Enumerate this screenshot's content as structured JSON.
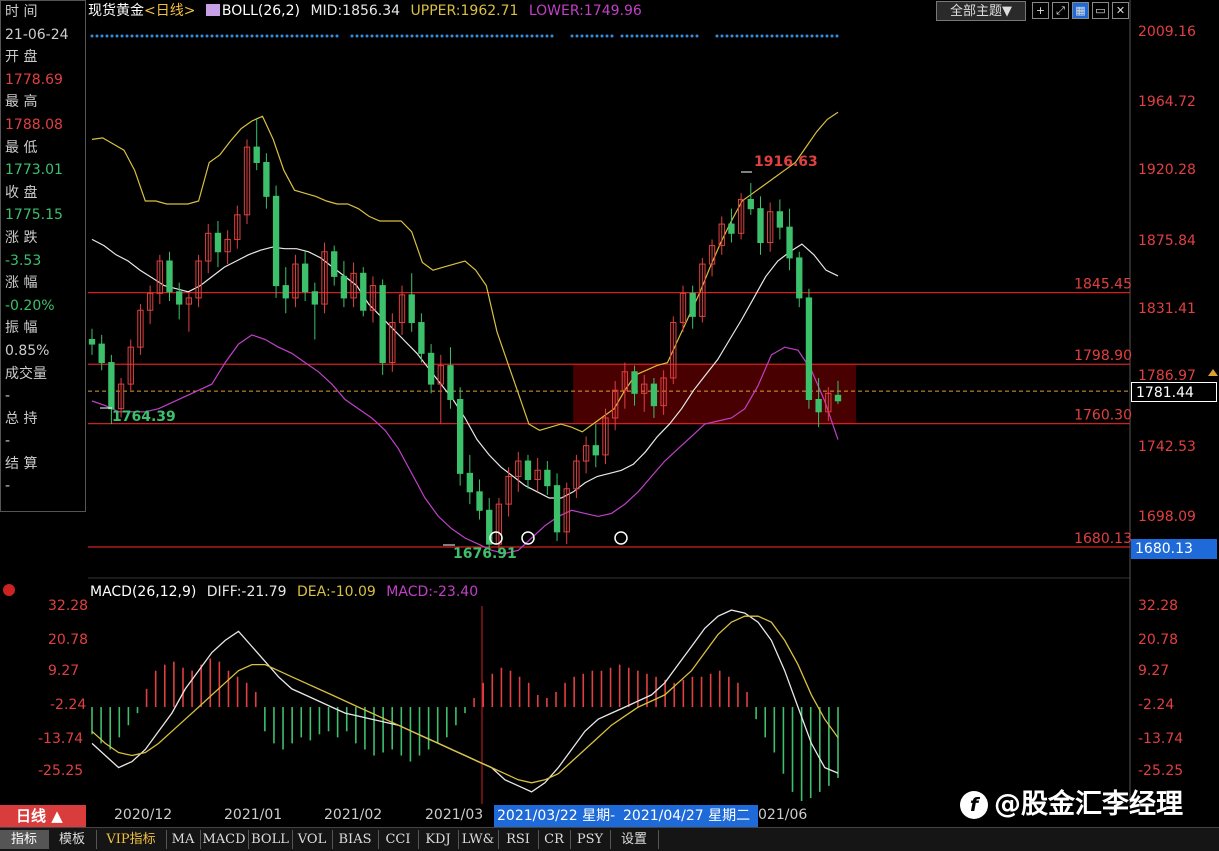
{
  "header": {
    "symbol": "现货黄金",
    "period": "<日线>",
    "indicator": "BOLL(26,2)",
    "mid": "MID:1856.34",
    "upper": "UPPER:1962.71",
    "lower": "LOWER:1749.96",
    "theme_button": "全部主题▼"
  },
  "toolbar_icons": [
    "crosshair-icon",
    "expand-icon",
    "chart-icon",
    "minimize-icon",
    "close-icon"
  ],
  "info_panel": {
    "rows": [
      {
        "text": "时 间",
        "color": "#cccccc"
      },
      {
        "text": "21-06-24",
        "color": "#cccccc"
      },
      {
        "text": "开 盘",
        "color": "#cccccc"
      },
      {
        "text": "1778.69",
        "color": "#e04040"
      },
      {
        "text": "最 高",
        "color": "#cccccc"
      },
      {
        "text": "1788.08",
        "color": "#e04040"
      },
      {
        "text": "最 低",
        "color": "#cccccc"
      },
      {
        "text": "1773.01",
        "color": "#3cc06c"
      },
      {
        "text": "收 盘",
        "color": "#cccccc"
      },
      {
        "text": "1775.15",
        "color": "#3cc06c"
      },
      {
        "text": "涨 跌",
        "color": "#cccccc"
      },
      {
        "text": "-3.53",
        "color": "#3cc06c"
      },
      {
        "text": "涨 幅",
        "color": "#cccccc"
      },
      {
        "text": "-0.20%",
        "color": "#3cc06c"
      },
      {
        "text": "振 幅",
        "color": "#cccccc"
      },
      {
        "text": "0.85%",
        "color": "#cccccc"
      },
      {
        "text": "成交量",
        "color": "#cccccc"
      },
      {
        "text": "-",
        "color": "#cccccc"
      },
      {
        "text": "总 持",
        "color": "#cccccc"
      },
      {
        "text": "-",
        "color": "#cccccc"
      },
      {
        "text": "结 算",
        "color": "#cccccc"
      },
      {
        "text": "-",
        "color": "#cccccc"
      }
    ]
  },
  "price_axis": {
    "ticks": [
      "2009.16",
      "1964.72",
      "1920.28",
      "1875.84",
      "1831.41",
      "1786.97",
      "1742.53",
      "1698.09"
    ],
    "current_price": "1781.44",
    "support_flag": "1680.13"
  },
  "levels": [
    {
      "label": "1845.45",
      "value": 1845.45
    },
    {
      "label": "1798.90",
      "value": 1798.9
    },
    {
      "label": "1760.30",
      "value": 1760.3
    },
    {
      "label": "1680.13",
      "value": 1680.13
    }
  ],
  "price_labels": {
    "high_label": "1916.63",
    "low_label": "1676.91",
    "start_label": "1764.39"
  },
  "macd": {
    "header_name": "MACD(26,12,9)",
    "diff": "DIFF:-21.79",
    "dea": "DEA:-10.09",
    "macd": "MACD:-23.40",
    "ticks": [
      "32.28",
      "20.78",
      "9.27",
      "-2.24",
      "-13.74",
      "-25.25"
    ]
  },
  "x_axis": {
    "labels": [
      "2020/12",
      "2021/01",
      "2021/02",
      "2021/03",
      "021/06"
    ],
    "cursor_date_1": "2021/03/22 星期-",
    "cursor_date_2": "2021/04/27 星期二"
  },
  "period_button": "日线 ▲",
  "tabs": [
    "指标",
    "模板",
    "VIP指标",
    "MA",
    "MACD",
    "BOLL",
    "VOL",
    "BIAS",
    "CCI",
    "KDJ",
    "LW&",
    "RSI",
    "CR",
    "PSY",
    "设置"
  ],
  "watermark": "@股金汇李经理",
  "colors": {
    "up": "#e04040",
    "down": "#3cc06c",
    "upper_band": "#d8c040",
    "mid_band": "#e8e8e8",
    "lower_band": "#c040c8",
    "level_line": "#d02020",
    "zone_fill": "#5a0000",
    "selected": "#1e6ad8"
  },
  "chart_data": {
    "type": "candlestick",
    "price_range": [
      1660,
      2020
    ],
    "candles": [
      {
        "o": 1815,
        "h": 1822,
        "l": 1805,
        "c": 1812
      },
      {
        "o": 1812,
        "h": 1818,
        "l": 1795,
        "c": 1800
      },
      {
        "o": 1800,
        "h": 1805,
        "l": 1760,
        "c": 1770
      },
      {
        "o": 1770,
        "h": 1790,
        "l": 1764.39,
        "c": 1786
      },
      {
        "o": 1786,
        "h": 1815,
        "l": 1782,
        "c": 1810
      },
      {
        "o": 1810,
        "h": 1838,
        "l": 1805,
        "c": 1834
      },
      {
        "o": 1834,
        "h": 1850,
        "l": 1825,
        "c": 1845
      },
      {
        "o": 1845,
        "h": 1870,
        "l": 1838,
        "c": 1866
      },
      {
        "o": 1866,
        "h": 1872,
        "l": 1840,
        "c": 1846
      },
      {
        "o": 1846,
        "h": 1852,
        "l": 1828,
        "c": 1838
      },
      {
        "o": 1838,
        "h": 1845,
        "l": 1820,
        "c": 1842
      },
      {
        "o": 1842,
        "h": 1870,
        "l": 1836,
        "c": 1866
      },
      {
        "o": 1866,
        "h": 1890,
        "l": 1858,
        "c": 1884
      },
      {
        "o": 1884,
        "h": 1892,
        "l": 1862,
        "c": 1872
      },
      {
        "o": 1872,
        "h": 1886,
        "l": 1864,
        "c": 1880
      },
      {
        "o": 1880,
        "h": 1902,
        "l": 1874,
        "c": 1896
      },
      {
        "o": 1896,
        "h": 1945,
        "l": 1890,
        "c": 1940
      },
      {
        "o": 1940,
        "h": 1959,
        "l": 1925,
        "c": 1930
      },
      {
        "o": 1930,
        "h": 1936,
        "l": 1900,
        "c": 1908
      },
      {
        "o": 1908,
        "h": 1915,
        "l": 1842,
        "c": 1850
      },
      {
        "o": 1850,
        "h": 1862,
        "l": 1832,
        "c": 1842
      },
      {
        "o": 1842,
        "h": 1870,
        "l": 1836,
        "c": 1864
      },
      {
        "o": 1864,
        "h": 1872,
        "l": 1840,
        "c": 1846
      },
      {
        "o": 1846,
        "h": 1852,
        "l": 1815,
        "c": 1838
      },
      {
        "o": 1838,
        "h": 1878,
        "l": 1832,
        "c": 1872
      },
      {
        "o": 1872,
        "h": 1876,
        "l": 1850,
        "c": 1856
      },
      {
        "o": 1856,
        "h": 1866,
        "l": 1836,
        "c": 1842
      },
      {
        "o": 1842,
        "h": 1865,
        "l": 1836,
        "c": 1858
      },
      {
        "o": 1858,
        "h": 1862,
        "l": 1830,
        "c": 1834
      },
      {
        "o": 1834,
        "h": 1856,
        "l": 1826,
        "c": 1850
      },
      {
        "o": 1850,
        "h": 1854,
        "l": 1792,
        "c": 1800
      },
      {
        "o": 1800,
        "h": 1832,
        "l": 1794,
        "c": 1826
      },
      {
        "o": 1826,
        "h": 1850,
        "l": 1818,
        "c": 1844
      },
      {
        "o": 1844,
        "h": 1858,
        "l": 1820,
        "c": 1826
      },
      {
        "o": 1826,
        "h": 1832,
        "l": 1800,
        "c": 1806
      },
      {
        "o": 1806,
        "h": 1812,
        "l": 1780,
        "c": 1786
      },
      {
        "o": 1786,
        "h": 1805,
        "l": 1760,
        "c": 1798
      },
      {
        "o": 1798,
        "h": 1810,
        "l": 1770,
        "c": 1776
      },
      {
        "o": 1776,
        "h": 1784,
        "l": 1720,
        "c": 1728
      },
      {
        "o": 1728,
        "h": 1740,
        "l": 1708,
        "c": 1716
      },
      {
        "o": 1716,
        "h": 1724,
        "l": 1698,
        "c": 1704
      },
      {
        "o": 1704,
        "h": 1712,
        "l": 1676.91,
        "c": 1682
      },
      {
        "o": 1682,
        "h": 1712,
        "l": 1678,
        "c": 1708
      },
      {
        "o": 1708,
        "h": 1732,
        "l": 1700,
        "c": 1726
      },
      {
        "o": 1726,
        "h": 1742,
        "l": 1716,
        "c": 1736
      },
      {
        "o": 1736,
        "h": 1740,
        "l": 1718,
        "c": 1724
      },
      {
        "o": 1724,
        "h": 1738,
        "l": 1716,
        "c": 1730
      },
      {
        "o": 1730,
        "h": 1736,
        "l": 1714,
        "c": 1720
      },
      {
        "o": 1720,
        "h": 1728,
        "l": 1684,
        "c": 1690
      },
      {
        "o": 1690,
        "h": 1722,
        "l": 1682,
        "c": 1718
      },
      {
        "o": 1718,
        "h": 1740,
        "l": 1712,
        "c": 1736
      },
      {
        "o": 1736,
        "h": 1752,
        "l": 1728,
        "c": 1746
      },
      {
        "o": 1746,
        "h": 1760,
        "l": 1732,
        "c": 1740
      },
      {
        "o": 1740,
        "h": 1770,
        "l": 1734,
        "c": 1764
      },
      {
        "o": 1764,
        "h": 1788,
        "l": 1756,
        "c": 1782
      },
      {
        "o": 1782,
        "h": 1800,
        "l": 1770,
        "c": 1794
      },
      {
        "o": 1794,
        "h": 1798,
        "l": 1772,
        "c": 1780
      },
      {
        "o": 1780,
        "h": 1792,
        "l": 1768,
        "c": 1786
      },
      {
        "o": 1786,
        "h": 1790,
        "l": 1764,
        "c": 1772
      },
      {
        "o": 1772,
        "h": 1795,
        "l": 1766,
        "c": 1790
      },
      {
        "o": 1790,
        "h": 1830,
        "l": 1786,
        "c": 1826
      },
      {
        "o": 1826,
        "h": 1850,
        "l": 1820,
        "c": 1845
      },
      {
        "o": 1845,
        "h": 1850,
        "l": 1822,
        "c": 1830
      },
      {
        "o": 1830,
        "h": 1868,
        "l": 1826,
        "c": 1864
      },
      {
        "o": 1864,
        "h": 1880,
        "l": 1856,
        "c": 1876
      },
      {
        "o": 1876,
        "h": 1895,
        "l": 1870,
        "c": 1890
      },
      {
        "o": 1890,
        "h": 1900,
        "l": 1878,
        "c": 1884
      },
      {
        "o": 1884,
        "h": 1910,
        "l": 1880,
        "c": 1906
      },
      {
        "o": 1906,
        "h": 1916.63,
        "l": 1896,
        "c": 1900
      },
      {
        "o": 1900,
        "h": 1908,
        "l": 1870,
        "c": 1878
      },
      {
        "o": 1878,
        "h": 1904,
        "l": 1872,
        "c": 1898
      },
      {
        "o": 1898,
        "h": 1906,
        "l": 1880,
        "c": 1888
      },
      {
        "o": 1888,
        "h": 1900,
        "l": 1860,
        "c": 1868
      },
      {
        "o": 1868,
        "h": 1872,
        "l": 1836,
        "c": 1842
      },
      {
        "o": 1842,
        "h": 1848,
        "l": 1770,
        "c": 1776
      },
      {
        "o": 1776,
        "h": 1790,
        "l": 1758,
        "c": 1768
      },
      {
        "o": 1768,
        "h": 1784,
        "l": 1762,
        "c": 1780
      },
      {
        "o": 1778.69,
        "h": 1788.08,
        "l": 1773.01,
        "c": 1775.15
      }
    ],
    "upper_band": [
      1945,
      1946,
      1942,
      1938,
      1925,
      1905,
      1905,
      1903,
      1903,
      1903,
      1905,
      1930,
      1935,
      1944,
      1952,
      1957,
      1960,
      1945,
      1925,
      1912,
      1910,
      1908,
      1905,
      1903,
      1903,
      1900,
      1895,
      1892,
      1892,
      1892,
      1885,
      1865,
      1860,
      1862,
      1864,
      1866,
      1860,
      1850,
      1820,
      1800,
      1780,
      1760,
      1756,
      1758,
      1760,
      1758,
      1755,
      1760,
      1765,
      1770,
      1782,
      1792,
      1795,
      1798,
      1800,
      1815,
      1830,
      1845,
      1862,
      1878,
      1892,
      1905,
      1910,
      1915,
      1920,
      1925,
      1930,
      1940,
      1950,
      1958,
      1962.71
    ],
    "mid_band": [
      1880,
      1876,
      1870,
      1866,
      1860,
      1855,
      1850,
      1848,
      1846,
      1850,
      1856,
      1862,
      1866,
      1870,
      1873,
      1875,
      1874,
      1874,
      1872,
      1868,
      1862,
      1856,
      1850,
      1838,
      1830,
      1822,
      1814,
      1806,
      1796,
      1786,
      1776,
      1764,
      1750,
      1740,
      1732,
      1726,
      1720,
      1716,
      1712,
      1712,
      1716,
      1722,
      1726,
      1728,
      1730,
      1734,
      1742,
      1752,
      1760,
      1770,
      1782,
      1792,
      1802,
      1815,
      1828,
      1842,
      1856,
      1866,
      1872,
      1877,
      1870,
      1860,
      1856.34
    ],
    "lower_band": [
      1775,
      1772,
      1768,
      1768,
      1768,
      1770,
      1774,
      1778,
      1782,
      1786,
      1800,
      1812,
      1818,
      1815,
      1810,
      1806,
      1800,
      1794,
      1786,
      1776,
      1770,
      1764,
      1756,
      1744,
      1728,
      1712,
      1700,
      1692,
      1686,
      1682,
      1678,
      1676,
      1678,
      1686,
      1694,
      1700,
      1704,
      1702,
      1700,
      1702,
      1708,
      1716,
      1726,
      1736,
      1744,
      1752,
      1760,
      1762,
      1764,
      1770,
      1785,
      1805,
      1810,
      1808,
      1795,
      1775,
      1749.96
    ],
    "macd_range": [
      -32,
      36
    ],
    "macd_hist": [
      -9,
      -12,
      -14,
      -10,
      -6,
      -2,
      6,
      12,
      14,
      15,
      13,
      12,
      14,
      16,
      15,
      12,
      10,
      8,
      5,
      -8,
      -12,
      -14,
      -12,
      -10,
      -11,
      -9,
      -8,
      -10,
      -8,
      -12,
      -14,
      -16,
      -15,
      -14,
      -16,
      -18,
      -16,
      -14,
      -12,
      -10,
      -6,
      -2,
      3,
      8,
      11,
      13,
      12,
      10,
      8,
      4,
      3,
      5,
      8,
      10,
      11,
      12,
      12,
      13,
      14,
      13,
      12,
      11,
      10,
      9,
      8,
      9,
      10,
      10,
      11,
      12,
      10,
      8,
      5,
      -4,
      -10,
      -15,
      -22,
      -28,
      -31,
      -30,
      -28,
      -26,
      -23.4
    ],
    "macd_diff": [
      -12,
      -16,
      -20,
      -18,
      -14,
      -8,
      -2,
      6,
      12,
      18,
      22,
      25,
      20,
      15,
      10,
      6,
      4,
      2,
      0,
      -2,
      -3,
      -4,
      -5,
      -6,
      -8,
      -10,
      -12,
      -14,
      -16,
      -18,
      -20,
      -24,
      -26,
      -28,
      -25,
      -20,
      -14,
      -8,
      -4,
      -2,
      0,
      2,
      4,
      8,
      14,
      20,
      26,
      30,
      32,
      31,
      28,
      22,
      12,
      0,
      -12,
      -20,
      -21.79
    ],
    "macd_dea": [
      -8,
      -12,
      -15,
      -16,
      -15,
      -12,
      -8,
      -4,
      0,
      4,
      8,
      12,
      14,
      14,
      12,
      10,
      8,
      6,
      4,
      2,
      0,
      -2,
      -4,
      -6,
      -8,
      -10,
      -12,
      -14,
      -16,
      -18,
      -20,
      -22,
      -24,
      -25,
      -24,
      -22,
      -18,
      -14,
      -10,
      -6,
      -3,
      0,
      2,
      4,
      8,
      12,
      18,
      24,
      28,
      30,
      30,
      28,
      22,
      14,
      4,
      -4,
      -10.09
    ]
  }
}
